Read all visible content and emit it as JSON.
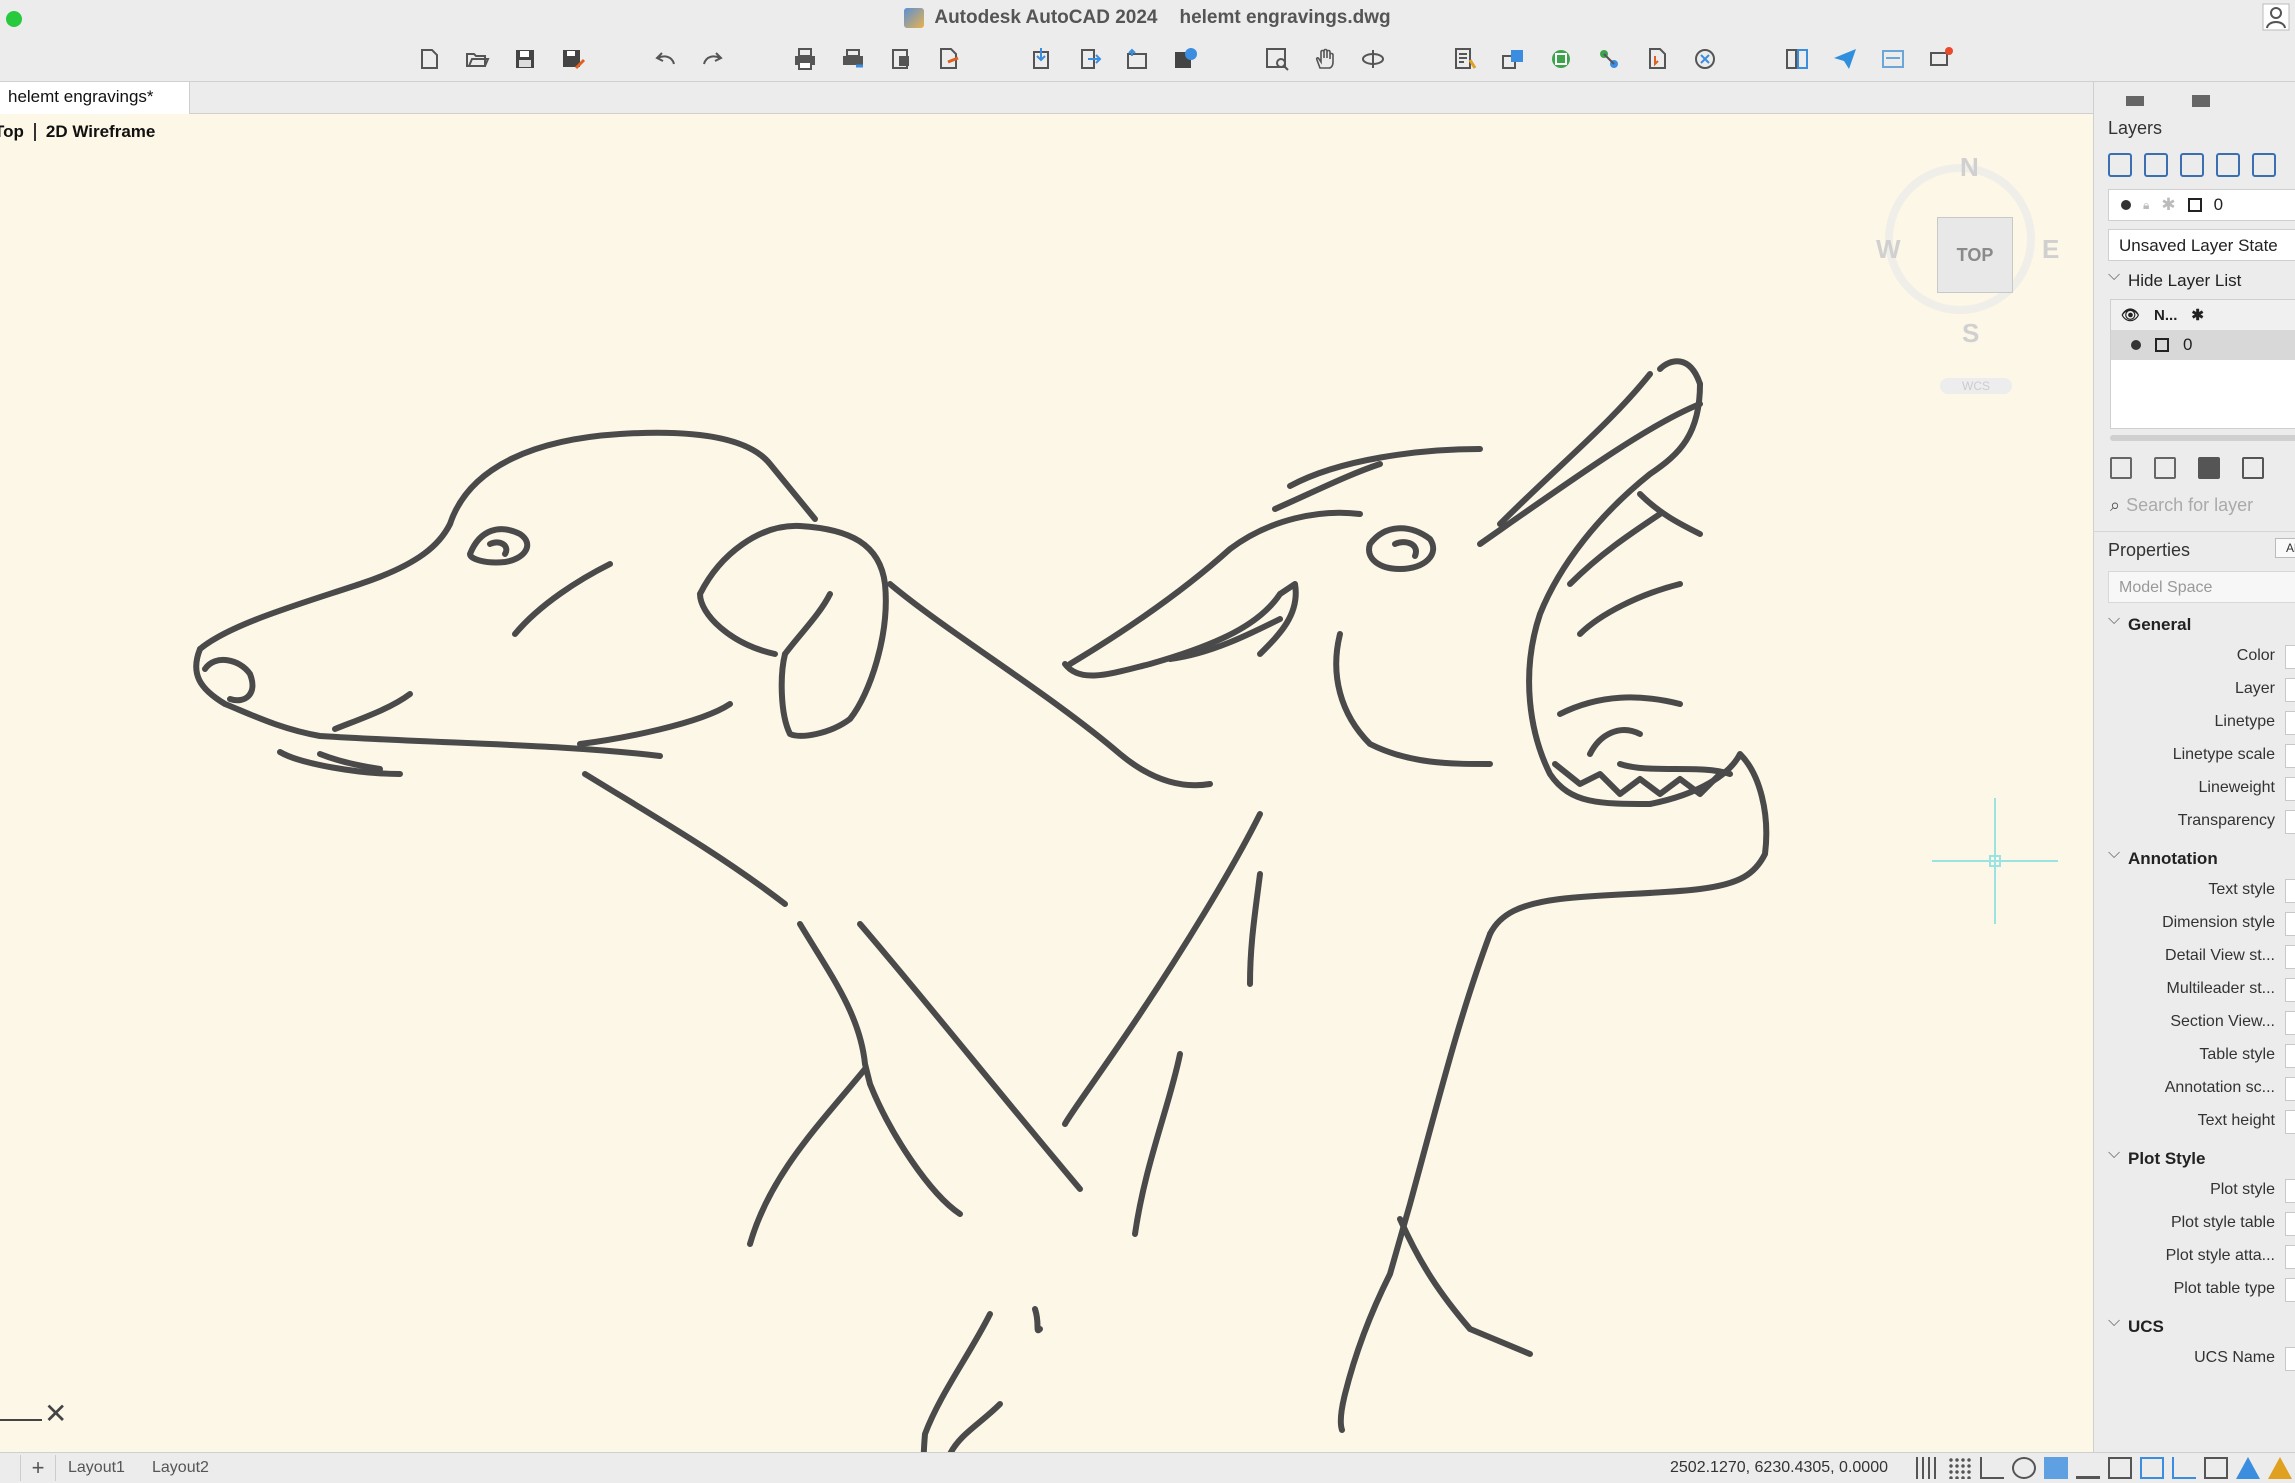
{
  "titlebar": {
    "app_name": "Autodesk AutoCAD 2024",
    "file_name": "helemt engravings.dwg"
  },
  "toolbar": {
    "buttons": [
      "new-icon",
      "open-icon",
      "save-icon",
      "save-as-icon",
      "undo-icon",
      "redo-icon",
      "plot-icon",
      "batch-plot-icon",
      "page-setup-icon",
      "publish-icon",
      "import-icon",
      "export-icon",
      "share-icon",
      "save-to-web-icon",
      "zoom-icon",
      "pan-icon",
      "orbit-icon",
      "properties-icon",
      "match-icon",
      "insert-icon",
      "group-icon",
      "attach-icon",
      "xref-icon",
      "sheetset-icon",
      "send-icon",
      "markup-icon",
      "notify-icon"
    ]
  },
  "document": {
    "tab_label": "helemt engravings*"
  },
  "viewport": {
    "view_name": "Top",
    "visual_style": "2D Wireframe"
  },
  "viewcube": {
    "top_label": "TOP",
    "north": "N",
    "south": "S",
    "east": "E",
    "west": "W",
    "wcs": "WCS"
  },
  "layers_panel": {
    "title": "Layers",
    "current_layer": "0",
    "layer_state": "Unsaved Layer State",
    "hide_list_label": "Hide Layer List",
    "column_name": "N...",
    "rows": [
      {
        "name": "0"
      }
    ],
    "search_placeholder": "Search for layer"
  },
  "properties_panel": {
    "title": "Properties",
    "filter_label": "All",
    "space": "Model Space",
    "sections": [
      {
        "title": "General",
        "rows": [
          "Color",
          "Layer",
          "Linetype",
          "Linetype scale",
          "Lineweight",
          "Transparency"
        ]
      },
      {
        "title": "Annotation",
        "rows": [
          "Text style",
          "Dimension style",
          "Detail View st...",
          "Multileader st...",
          "Section View...",
          "Table style",
          "Annotation sc...",
          "Text height"
        ]
      },
      {
        "title": "Plot Style",
        "rows": [
          "Plot style",
          "Plot style table",
          "Plot style atta...",
          "Plot table type"
        ]
      },
      {
        "title": "UCS",
        "rows": [
          "UCS Name"
        ]
      }
    ]
  },
  "statusbar": {
    "plus_label": "+",
    "layouts": [
      "Layout1",
      "Layout2"
    ],
    "coordinates": "2502.1270, 6230.4305, 0.0000"
  },
  "colors": {
    "canvas_bg": "#fdf7e7",
    "crosshair": "#9be3e3",
    "chrome": "#ececec",
    "traffic_green": "#27c93f"
  }
}
